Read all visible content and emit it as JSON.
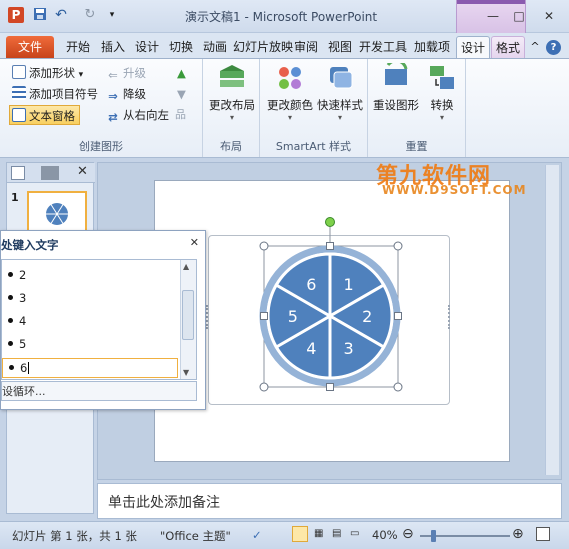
{
  "titlebar": {
    "app_badge": "P",
    "title": "演示文稿1 - Microsoft PowerPoint",
    "undo_symbol": "↶",
    "redo_symbol": "↻",
    "minimize_symbol": "—",
    "maximize_symbol": "□",
    "close_symbol": "✕"
  },
  "tabs": {
    "file": "文件",
    "items": [
      "开始",
      "插入",
      "设计",
      "切换",
      "动画",
      "幻灯片放映",
      "审阅",
      "视图",
      "开发工具",
      "加载项"
    ],
    "context_design": "设计",
    "context_format": "格式",
    "collapse_symbol": "^",
    "help_symbol": "?"
  },
  "ribbon": {
    "group_create": {
      "label": "创建图形",
      "add_shape": "添加形状",
      "add_bullet": "添加项目符号",
      "text_pane": "文本窗格",
      "promote": "升级",
      "demote": "降级",
      "right_to_left": "从右向左"
    },
    "group_layout": {
      "label": "布局",
      "change_layout": "更改布局"
    },
    "group_smartart": {
      "label": "SmartArt 样式",
      "change_colors": "更改颜色",
      "quick_styles": "快速样式"
    },
    "group_reset": {
      "label": "重置",
      "reset_graphic": "重设图形",
      "convert": "转换"
    }
  },
  "slide_pane": {
    "slide_number": "1"
  },
  "text_pane": {
    "title": "处键入文字",
    "close_symbol": "✕",
    "bullets": [
      "2",
      "3",
      "4",
      "5",
      "6"
    ],
    "footer": "设循环..."
  },
  "smartart": {
    "segments": [
      "1",
      "2",
      "3",
      "4",
      "5",
      "6"
    ],
    "colors": {
      "fill": "#4f81bd",
      "arrow": "#95b3d7",
      "line": "#ffffff"
    }
  },
  "notes": {
    "placeholder": "单击此处添加备注"
  },
  "statusbar": {
    "slide_info": "幻灯片 第 1 张，共 1 张",
    "theme": "\"Office 主题\"",
    "zoom": "40%",
    "minus_symbol": "⊖",
    "plus_symbol": "⊕"
  },
  "watermark": {
    "main": "第九软件网",
    "sub": "WWW.D9SOFT.COM"
  }
}
